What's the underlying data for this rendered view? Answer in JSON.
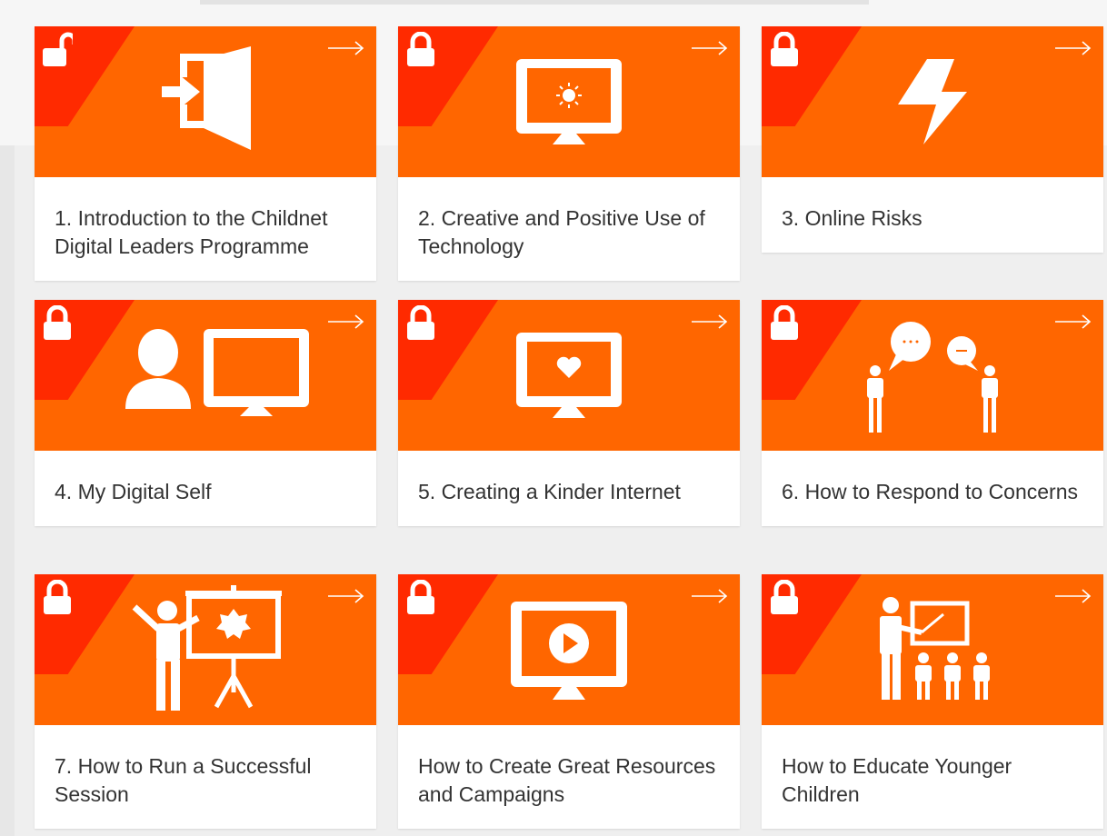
{
  "cards": [
    {
      "title": "1. Introduction to the Childnet Digital Leaders Programme",
      "lock": "unlocked-padlock-icon",
      "icon": "door-enter-icon"
    },
    {
      "title": "2. Creative and Positive Use of Technology",
      "lock": "locked-padlock-icon",
      "icon": "monitor-idea-icon"
    },
    {
      "title": "3. Online Risks",
      "lock": "locked-padlock-icon",
      "icon": "lightning-bolt-icon"
    },
    {
      "title": "4. My Digital Self",
      "lock": "locked-padlock-icon",
      "icon": "person-monitor-icon"
    },
    {
      "title": "5. Creating a Kinder Internet",
      "lock": "locked-padlock-icon",
      "icon": "monitor-heart-icon"
    },
    {
      "title": "6. How to Respond to Concerns",
      "lock": "locked-padlock-icon",
      "icon": "people-chat-icon"
    },
    {
      "title": "7. How to Run a Successful Session",
      "lock": "locked-padlock-icon",
      "icon": "presenter-icon"
    },
    {
      "title": "How to Create Great Resources and Campaigns",
      "lock": "locked-padlock-icon",
      "icon": "monitor-play-icon"
    },
    {
      "title": "How to Educate Younger Children",
      "lock": "locked-padlock-icon",
      "icon": "teacher-class-icon"
    }
  ],
  "colors": {
    "accent": "#ff6600",
    "corner": "#ff2a00",
    "text": "#333333"
  }
}
